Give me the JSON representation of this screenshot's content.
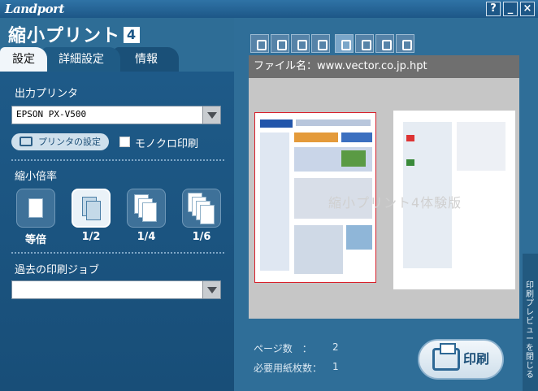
{
  "window": {
    "brand": "Landport",
    "help": "?",
    "minimize": "_",
    "close": "×"
  },
  "product": {
    "name": "縮小プリント",
    "version": "4"
  },
  "tabs": [
    {
      "label": "設定"
    },
    {
      "label": "詳細設定"
    },
    {
      "label": "情報"
    }
  ],
  "settings": {
    "output_printer_label": "出力プリンタ",
    "printer_value": "EPSON PX-V500",
    "printer_settings_button": "プリンタの設定",
    "mono_print_label": "モノクロ印刷",
    "ratio_label": "縮小倍率",
    "ratios": [
      {
        "label": "等倍"
      },
      {
        "label": "1/2"
      },
      {
        "label": "1/4"
      },
      {
        "label": "1/6"
      }
    ],
    "selected_ratio": "1/2",
    "past_jobs_label": "過去の印刷ジョブ",
    "past_jobs_value": ""
  },
  "preview": {
    "filename": "ファイル名：www.vector.co.jp.hpt",
    "watermark": "縮小プリント4体験版",
    "page_count_label": "ページ数　：",
    "page_count": "2",
    "sheets_label": "必要用紙枚数：",
    "sheets": "1",
    "print_button": "印刷",
    "close_preview": "印刷プレビューを閉じる"
  },
  "colors": {
    "panel": "#1e5a88",
    "accent": "#2f6e98",
    "selection": "#d8202a"
  }
}
